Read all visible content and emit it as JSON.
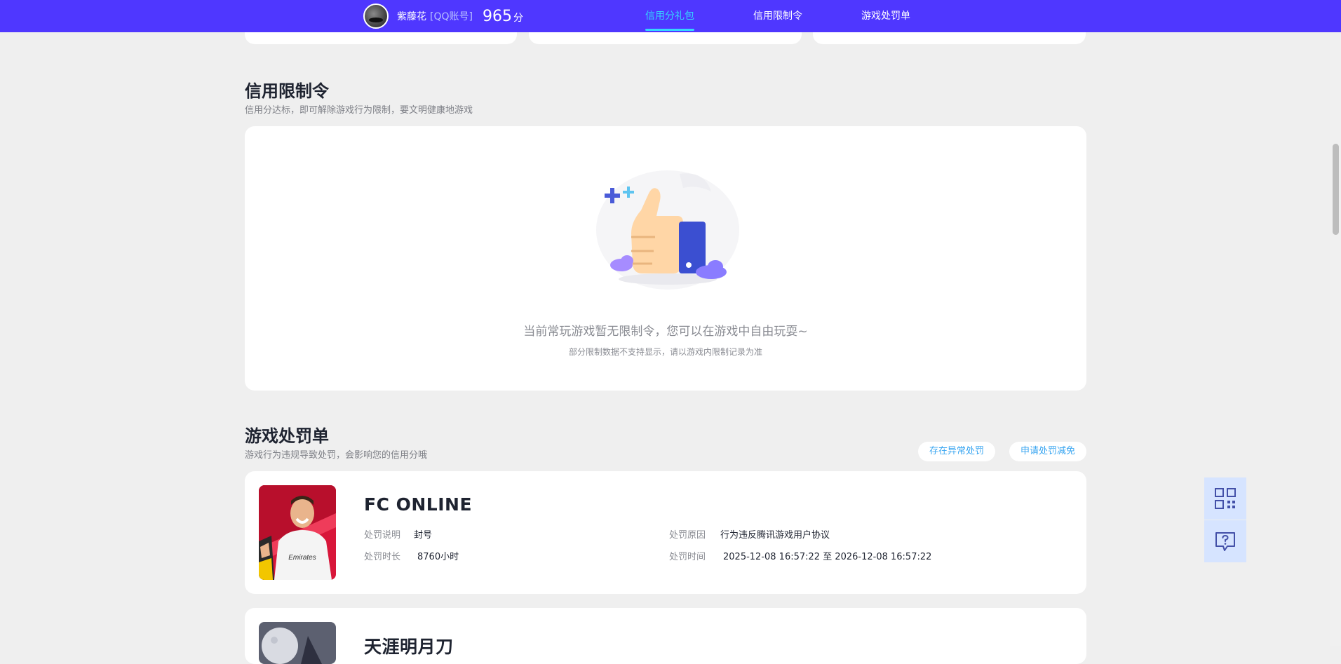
{
  "user": {
    "name": "紫藤花",
    "account_type": "[QQ账号]",
    "score": "965",
    "score_unit": "分"
  },
  "nav": {
    "tabs": [
      {
        "label": "信用分礼包",
        "active": true
      },
      {
        "label": "信用限制令",
        "active": false
      },
      {
        "label": "游戏处罚单",
        "active": false
      }
    ]
  },
  "restriction": {
    "title": "信用限制令",
    "subtitle": "信用分达标，即可解除游戏行为限制，要文明健康地游戏",
    "empty_main": "当前常玩游戏暂无限制令，您可以在游戏中自由玩耍~",
    "empty_note": "部分限制数据不支持显示，请以游戏内限制记录为准"
  },
  "penalty": {
    "title": "游戏处罚单",
    "subtitle": "游戏行为违规导致处罚，会影响您的信用分哦",
    "btn_abnormal": "存在异常处罚",
    "btn_appeal": "申请处罚减免",
    "items": [
      {
        "game": "FC ONLINE",
        "desc_label": "处罚说明",
        "desc": "封号",
        "reason_label": "处罚原因",
        "reason": "行为违反腾讯游戏用户协议",
        "duration_label": "处罚时长",
        "duration": "8760小时",
        "time_label": "处罚时间",
        "time": "2025-12-08 16:57:22 至 2026-12-08 16:57:22"
      },
      {
        "game": "天涯明月刀"
      }
    ]
  },
  "colors": {
    "nav_bg": "#4f37ff",
    "nav_active": "#34d5ff",
    "page_bg": "#efefef",
    "pill_text": "#3aa6f1"
  },
  "icons": [
    "qr-code-icon",
    "help-message-icon",
    "thumbs-up-illustration"
  ]
}
